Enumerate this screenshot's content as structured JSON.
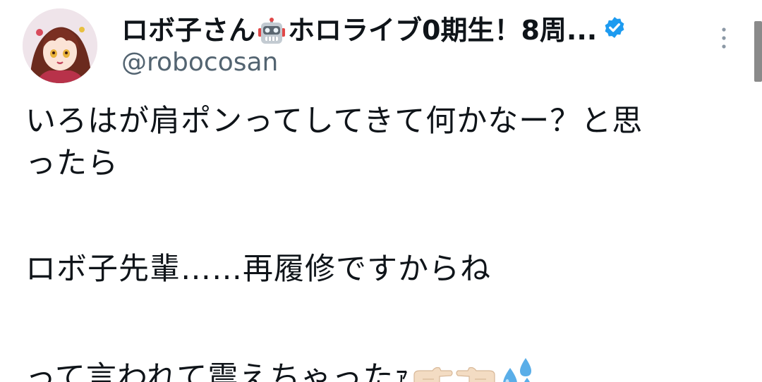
{
  "author": {
    "display_name_prefix": "ロボ子さん",
    "display_name_suffix": "ホロライブ0期生！8周...",
    "emoji_icon": "robot-face-icon",
    "handle": "@robocosan",
    "verified_icon": "verified-badge-icon",
    "verified_color": "#1d9bf0",
    "avatar_icon": "anime-avatar-icon"
  },
  "menu": {
    "icon": "more-vertical-icon"
  },
  "tweet": {
    "line1": "いろはが肩ポンってしてきて何かなー？と思",
    "line2": "ったら",
    "line3": "ロボ子先輩……再履修ですからね",
    "line4": "って言われて震えちゃったｧ",
    "trailing_emojis": [
      "pointing-right-icon",
      "pointing-left-icon",
      "sweat-droplets-icon"
    ]
  }
}
